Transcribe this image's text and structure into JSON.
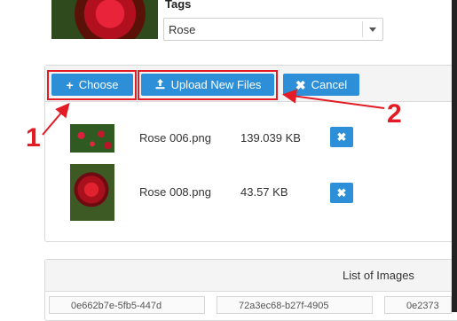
{
  "top": {
    "tags_label": "Tags",
    "tags_value": "Rose"
  },
  "toolbar": {
    "choose_label": "Choose",
    "upload_label": "Upload New Files",
    "cancel_label": "Cancel",
    "choose_icon": "plus-icon",
    "upload_icon": "upload-icon",
    "cancel_icon": "x-icon"
  },
  "files": [
    {
      "name": "Rose 006.png",
      "size": "139.039 KB"
    },
    {
      "name": "Rose 008.png",
      "size": "43.57 KB"
    }
  ],
  "annotations": {
    "one": "1",
    "two": "2",
    "color": "#e21b24"
  },
  "list": {
    "title": "List of Images",
    "ids": [
      "0e662b7e-5fb5-447d",
      "72a3ec68-b27f-4905",
      "0e2373"
    ]
  },
  "colors": {
    "button": "#2d8fd8",
    "highlight": "#e21b24"
  }
}
